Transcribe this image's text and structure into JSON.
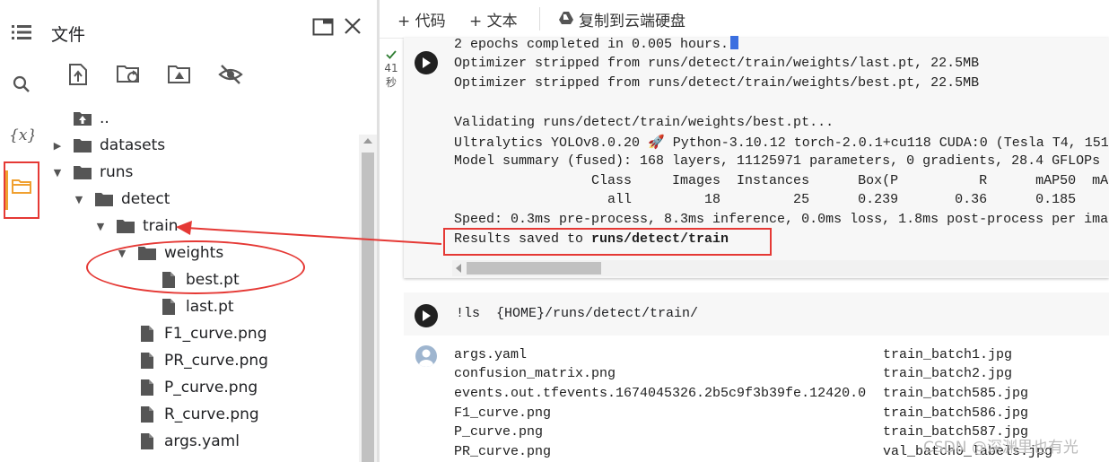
{
  "sidebar": {
    "title": "文件",
    "tree": [
      {
        "label": "..",
        "kind": "up"
      },
      {
        "label": "datasets",
        "kind": "folder",
        "toggle": "collapsed"
      },
      {
        "label": "runs",
        "kind": "folder",
        "toggle": "expanded"
      },
      {
        "label": "detect",
        "kind": "folder",
        "toggle": "expanded"
      },
      {
        "label": "train",
        "kind": "folder",
        "toggle": "expanded"
      },
      {
        "label": "weights",
        "kind": "folder",
        "toggle": "expanded"
      },
      {
        "label": "best.pt",
        "kind": "file"
      },
      {
        "label": "last.pt",
        "kind": "file"
      },
      {
        "label": "F1_curve.png",
        "kind": "file"
      },
      {
        "label": "PR_curve.png",
        "kind": "file"
      },
      {
        "label": "P_curve.png",
        "kind": "file"
      },
      {
        "label": "R_curve.png",
        "kind": "file"
      },
      {
        "label": "args.yaml",
        "kind": "file"
      }
    ]
  },
  "toolbar": {
    "code_label": "+ 代码",
    "text_label": "+ 文本",
    "drive_label": "复制到云端硬盘"
  },
  "cell1": {
    "exec_time": "41",
    "exec_unit": "秒",
    "output": [
      "2 epochs completed in 0.005 hours.",
      "Optimizer stripped from runs/detect/train/weights/last.pt, 22.5MB",
      "Optimizer stripped from runs/detect/train/weights/best.pt, 22.5MB",
      "",
      "Validating runs/detect/train/weights/best.pt...",
      "Ultralytics YOLOv8.0.20 🚀 Python-3.10.12 torch-2.0.1+cu118 CUDA:0 (Tesla T4, 151",
      "Model summary (fused): 168 layers, 11125971 parameters, 0 gradients, 28.4 GFLOPs",
      "                 Class     Images  Instances      Box(P          R      mAP50  mA",
      "                   all         18         25      0.239       0.36      0.185",
      "Speed: 0.3ms pre-process, 8.3ms inference, 0.0ms loss, 1.8ms post-process per ima"
    ],
    "results_prefix": "Results saved to ",
    "results_path": "runs/detect/train"
  },
  "cell2": {
    "code_prefix": "!ls  ",
    "code_arg": "{HOME}/runs/detect/train/",
    "listing_left": [
      "args.yaml",
      "confusion_matrix.png",
      "events.out.tfevents.1674045326.2b5c9f3b39fe.12420.0",
      "F1_curve.png",
      "P_curve.png",
      "PR_curve.png"
    ],
    "listing_right": [
      "train_batch1.jpg",
      "train_batch2.jpg",
      "train_batch585.jpg",
      "train_batch586.jpg",
      "train_batch587.jpg",
      "val_batch0_labels.jpg"
    ]
  },
  "watermark": "CSDN @深渊里也有光",
  "colors": {
    "annotation": "#e53935",
    "rail_accent": "#f0a030"
  }
}
